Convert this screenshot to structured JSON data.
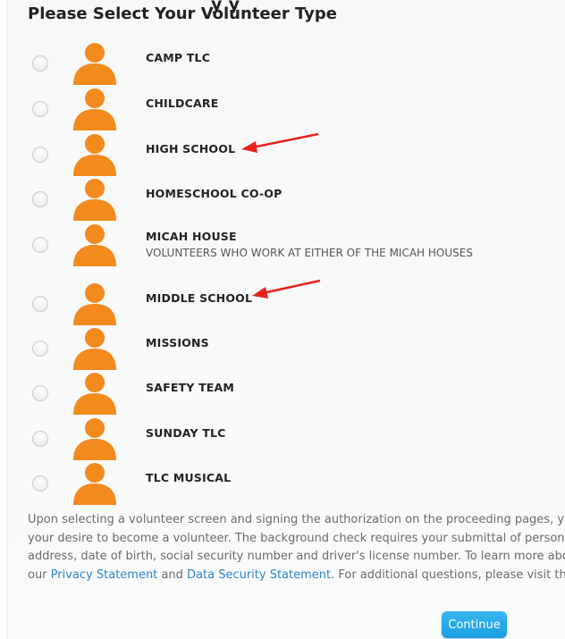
{
  "heading": "Please Select Your Volunteer Type",
  "clipped_heading_fragment": "y y",
  "options": [
    {
      "label": "CAMP TLC",
      "description": ""
    },
    {
      "label": "CHILDCARE",
      "description": ""
    },
    {
      "label": "HIGH SCHOOL",
      "description": ""
    },
    {
      "label": "HOMESCHOOL CO-OP",
      "description": ""
    },
    {
      "label": "MICAH HOUSE",
      "description": "VOLUNTEERS WHO WORK AT EITHER OF THE MICAH HOUSES"
    },
    {
      "label": "MIDDLE SCHOOL",
      "description": ""
    },
    {
      "label": "MISSIONS",
      "description": ""
    },
    {
      "label": "SAFETY TEAM",
      "description": ""
    },
    {
      "label": "SUNDAY TLC",
      "description": ""
    },
    {
      "label": "TLC MUSICAL",
      "description": ""
    }
  ],
  "disclaimer": {
    "line1": "Upon selecting a volunteer screen and signing the authorization on the proceeding pages, yo",
    "line2": "your desire to become a volunteer. The background check requires your submittal of persona",
    "line3": "address, date of birth, social security number and driver's license number. To learn more abo",
    "line4_prefix": "our ",
    "privacy_link": "Privacy Statement",
    "and_text": " and ",
    "security_link": "Data Security Statement",
    "line4_suffix": ". For additional questions, please visit th"
  },
  "continue_label": "Continue",
  "colors": {
    "avatar": "#f28a1e",
    "arrow": "#e8231f",
    "link": "#2a86c8",
    "button": "#1fa7e6"
  }
}
